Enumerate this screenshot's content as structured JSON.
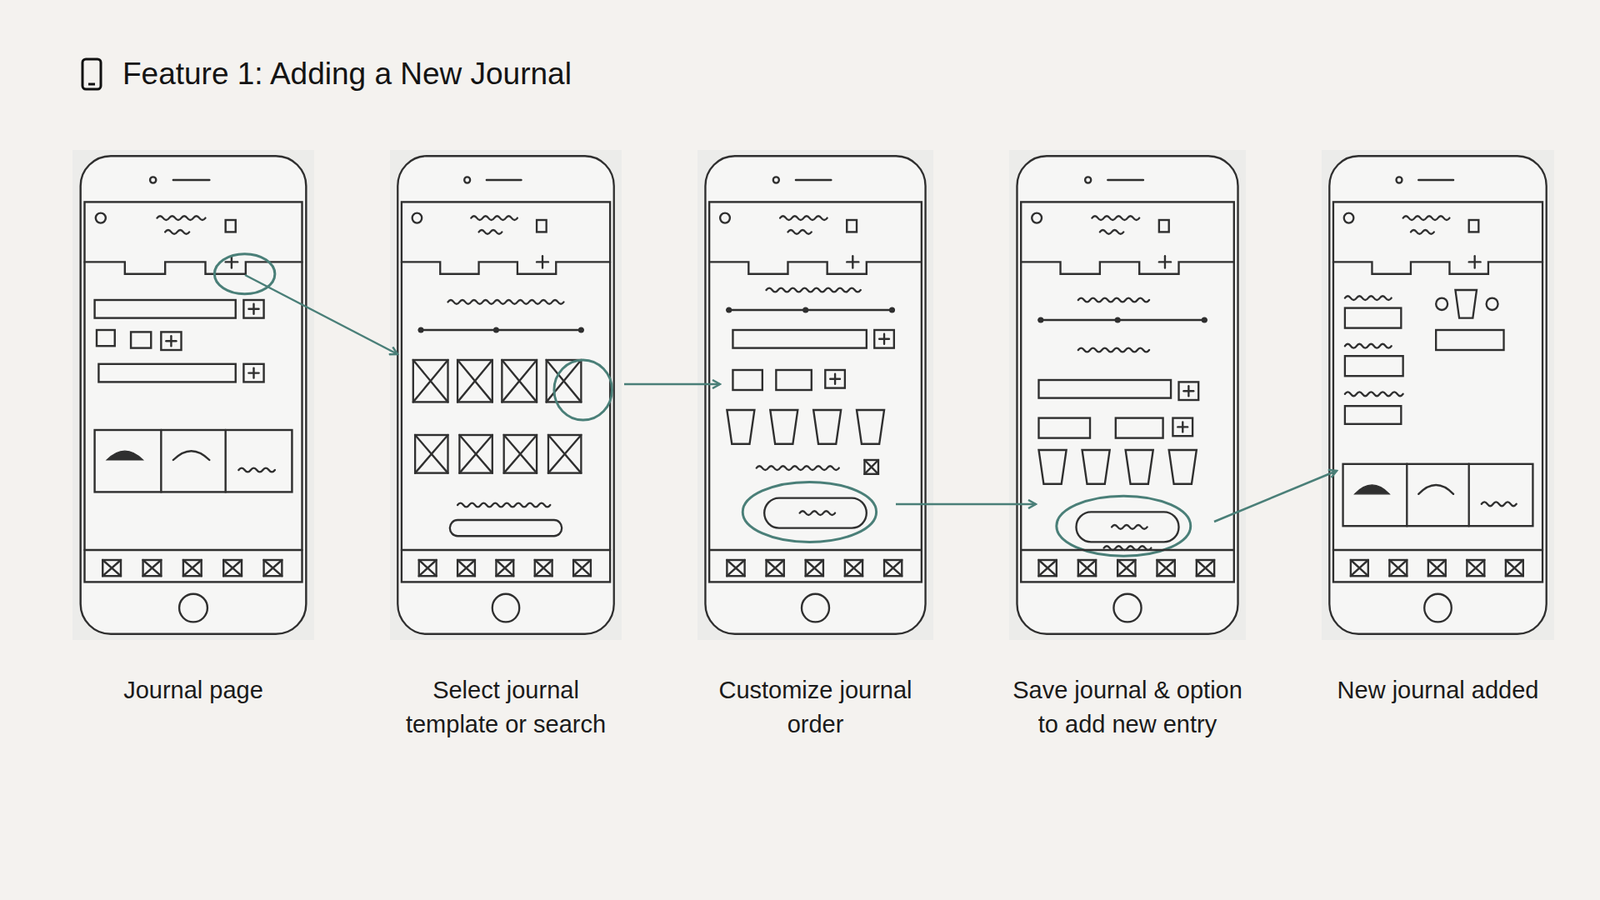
{
  "slide": {
    "title": "Feature 1: Adding a New Journal"
  },
  "steps": [
    {
      "caption": "Journal page",
      "kind": "journal"
    },
    {
      "caption": "Select journal template or search",
      "kind": "templates"
    },
    {
      "caption": "Customize journal order",
      "kind": "customize"
    },
    {
      "caption": "Save journal & option to add new entry",
      "kind": "save"
    },
    {
      "caption": "New journal added",
      "kind": "added"
    }
  ]
}
